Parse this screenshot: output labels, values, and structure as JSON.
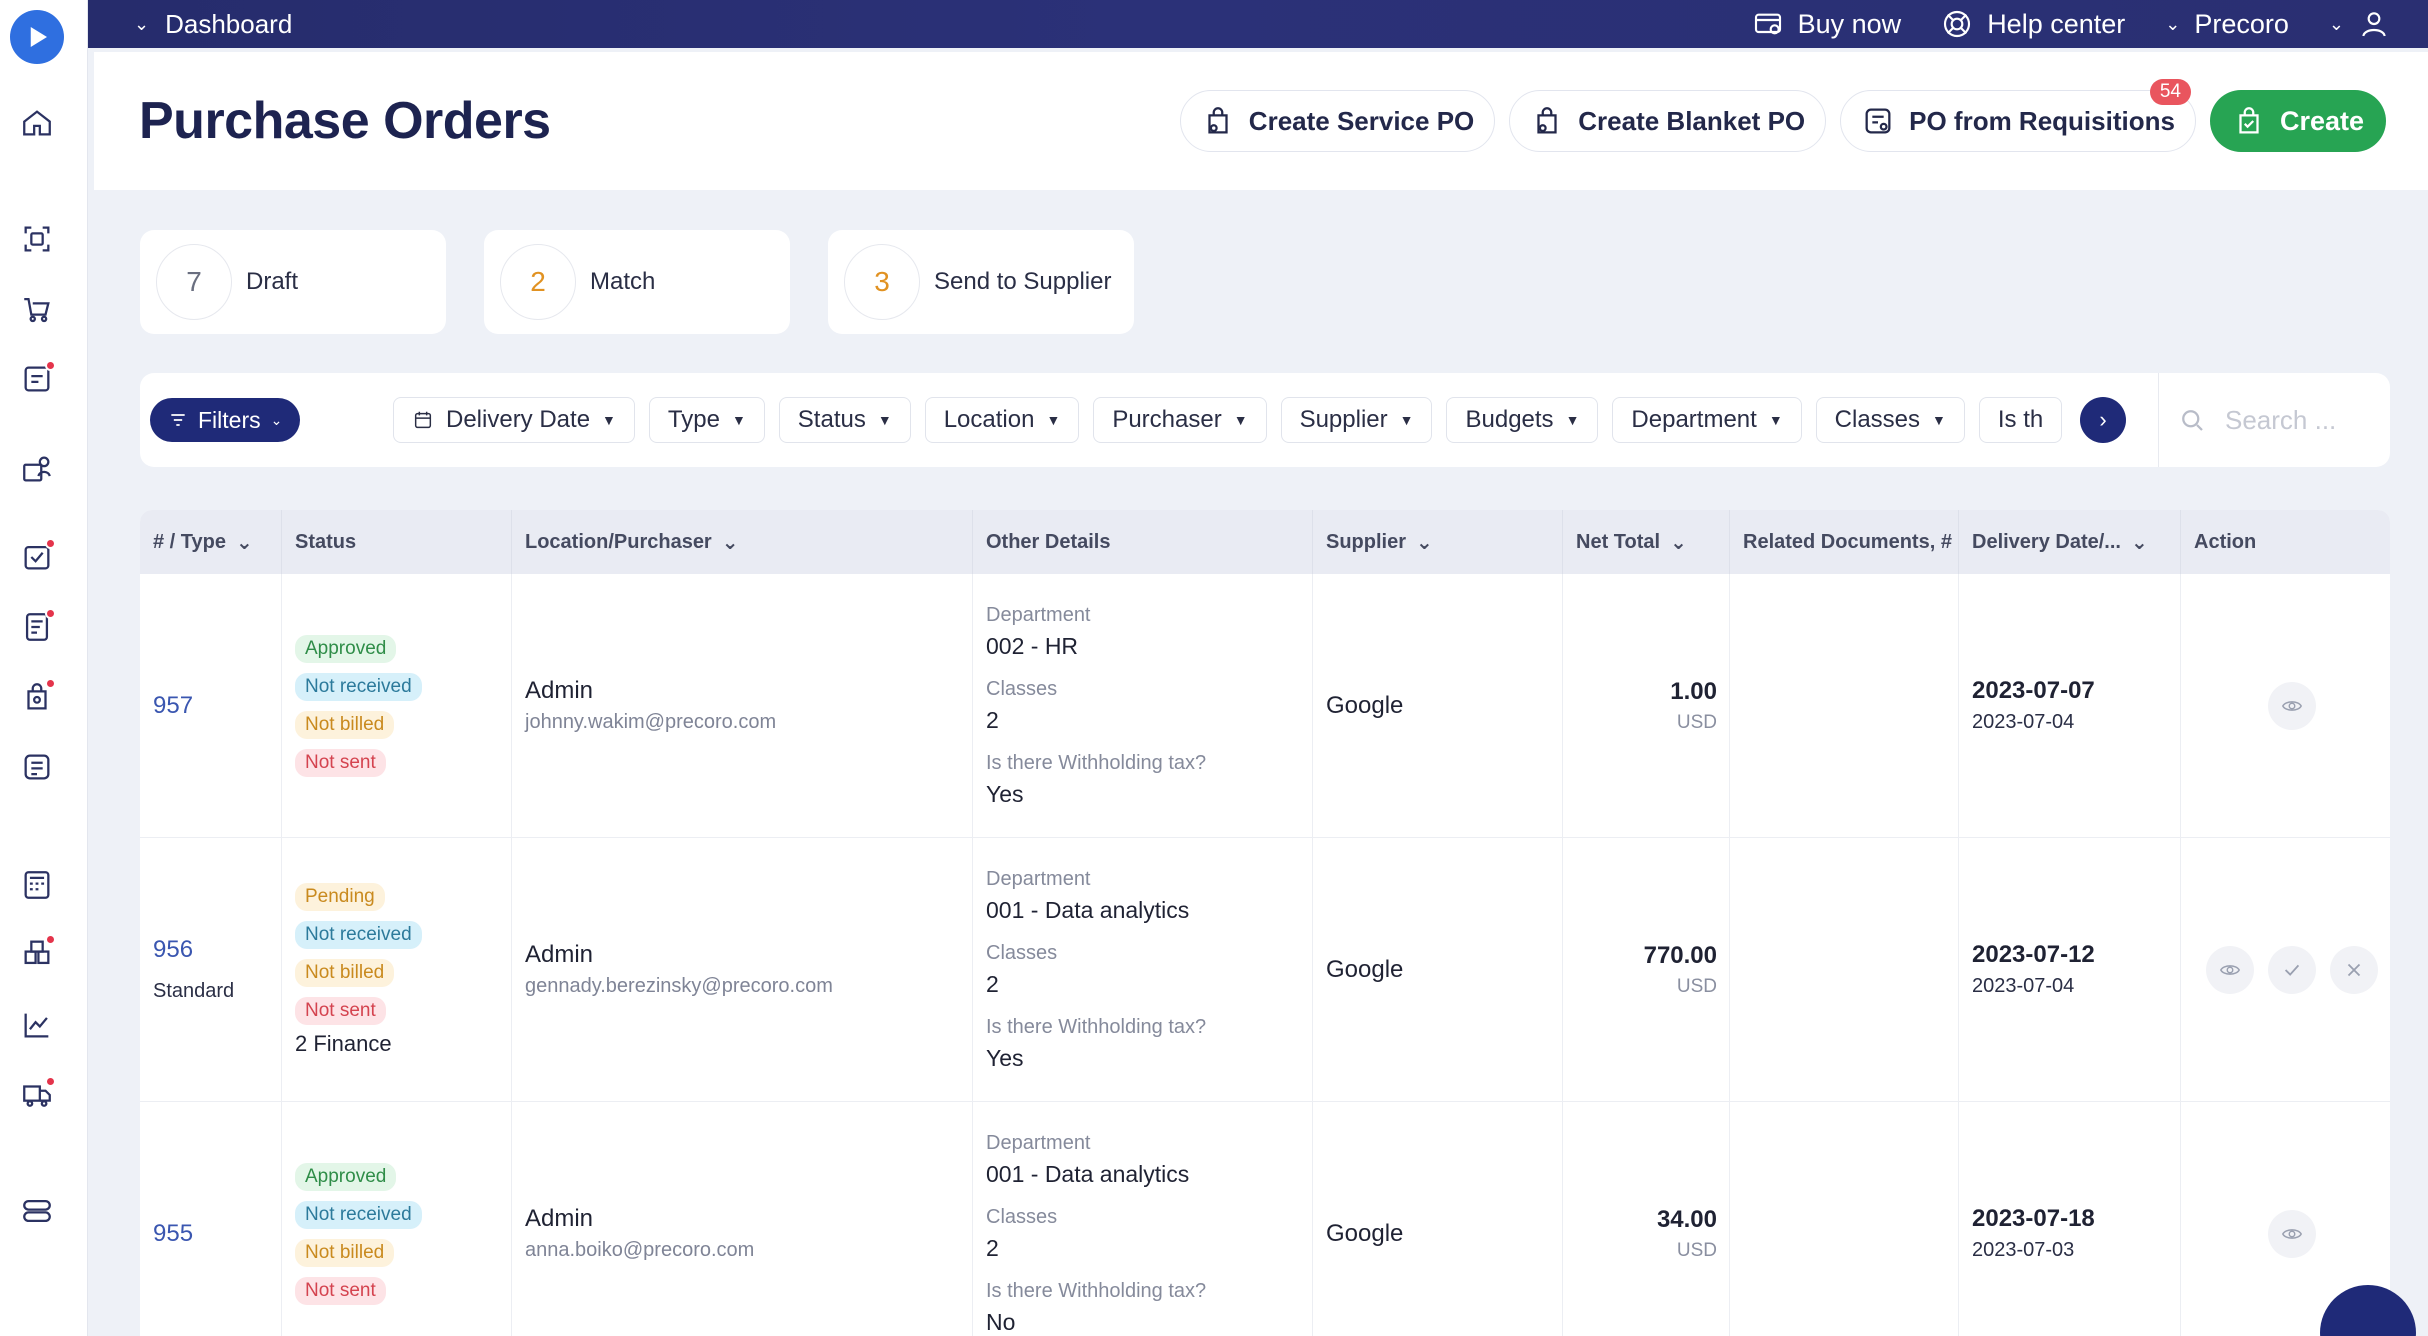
{
  "topbar": {
    "dashboard_label": "Dashboard",
    "buy_now": "Buy now",
    "help_center": "Help center",
    "company": "Precoro"
  },
  "header": {
    "title": "Purchase Orders",
    "create_service_po": "Create Service PO",
    "create_blanket_po": "Create Blanket PO",
    "po_from_requisitions": "PO from Requisitions",
    "requisitions_count": "54",
    "create": "Create"
  },
  "cards": [
    {
      "count": "7",
      "label": "Draft"
    },
    {
      "count": "2",
      "label": "Match"
    },
    {
      "count": "3",
      "label": "Send to Supplier"
    }
  ],
  "filters": {
    "filters_label": "Filters",
    "chips": [
      "Delivery Date",
      "Type",
      "Status",
      "Location",
      "Purchaser",
      "Supplier",
      "Budgets",
      "Department",
      "Classes",
      "Is th"
    ],
    "search_placeholder": "Search ..."
  },
  "table": {
    "columns": [
      "# / Type",
      "Status",
      "Location/Purchaser",
      "Other Details",
      "Supplier",
      "Net Total",
      "Related Documents, #",
      "Delivery Date/...",
      "Action"
    ],
    "rows": [
      {
        "number": "957",
        "type": "",
        "statuses": [
          "Approved",
          "Not received",
          "Not billed",
          "Not sent"
        ],
        "extra": "",
        "person": "Admin",
        "email": "johnny.wakim@precoro.com",
        "department_label": "Department",
        "department": "002 - HR",
        "classes_label": "Classes",
        "classes": "2",
        "tax_label": "Is there Withholding tax?",
        "tax": "Yes",
        "supplier": "Google",
        "net_total": "1.00",
        "currency": "USD",
        "delivery_date": "2023-07-07",
        "created_date": "2023-07-04"
      },
      {
        "number": "956",
        "type": "Standard",
        "statuses": [
          "Pending",
          "Not received",
          "Not billed",
          "Not sent"
        ],
        "extra": "2 Finance",
        "person": "Admin",
        "email": "gennady.berezinsky@precoro.com",
        "department_label": "Department",
        "department": "001 - Data analytics",
        "classes_label": "Classes",
        "classes": "2",
        "tax_label": "Is there Withholding tax?",
        "tax": "Yes",
        "supplier": "Google",
        "net_total": "770.00",
        "currency": "USD",
        "delivery_date": "2023-07-12",
        "created_date": "2023-07-04"
      },
      {
        "number": "955",
        "type": "",
        "statuses": [
          "Approved",
          "Not received",
          "Not billed",
          "Not sent"
        ],
        "extra": "",
        "person": "Admin",
        "email": "anna.boiko@precoro.com",
        "department_label": "Department",
        "department": "001 - Data analytics",
        "classes_label": "Classes",
        "classes": "2",
        "tax_label": "Is there Withholding tax?",
        "tax": "No",
        "supplier": "Google",
        "net_total": "34.00",
        "currency": "USD",
        "delivery_date": "2023-07-18",
        "created_date": "2023-07-03"
      }
    ]
  },
  "colors": {
    "topbar": "#262c6c",
    "primary_button": "#1f2a78",
    "create_green": "#27a453",
    "link_blue": "#3a56b0",
    "alert_red": "#e4344b"
  }
}
